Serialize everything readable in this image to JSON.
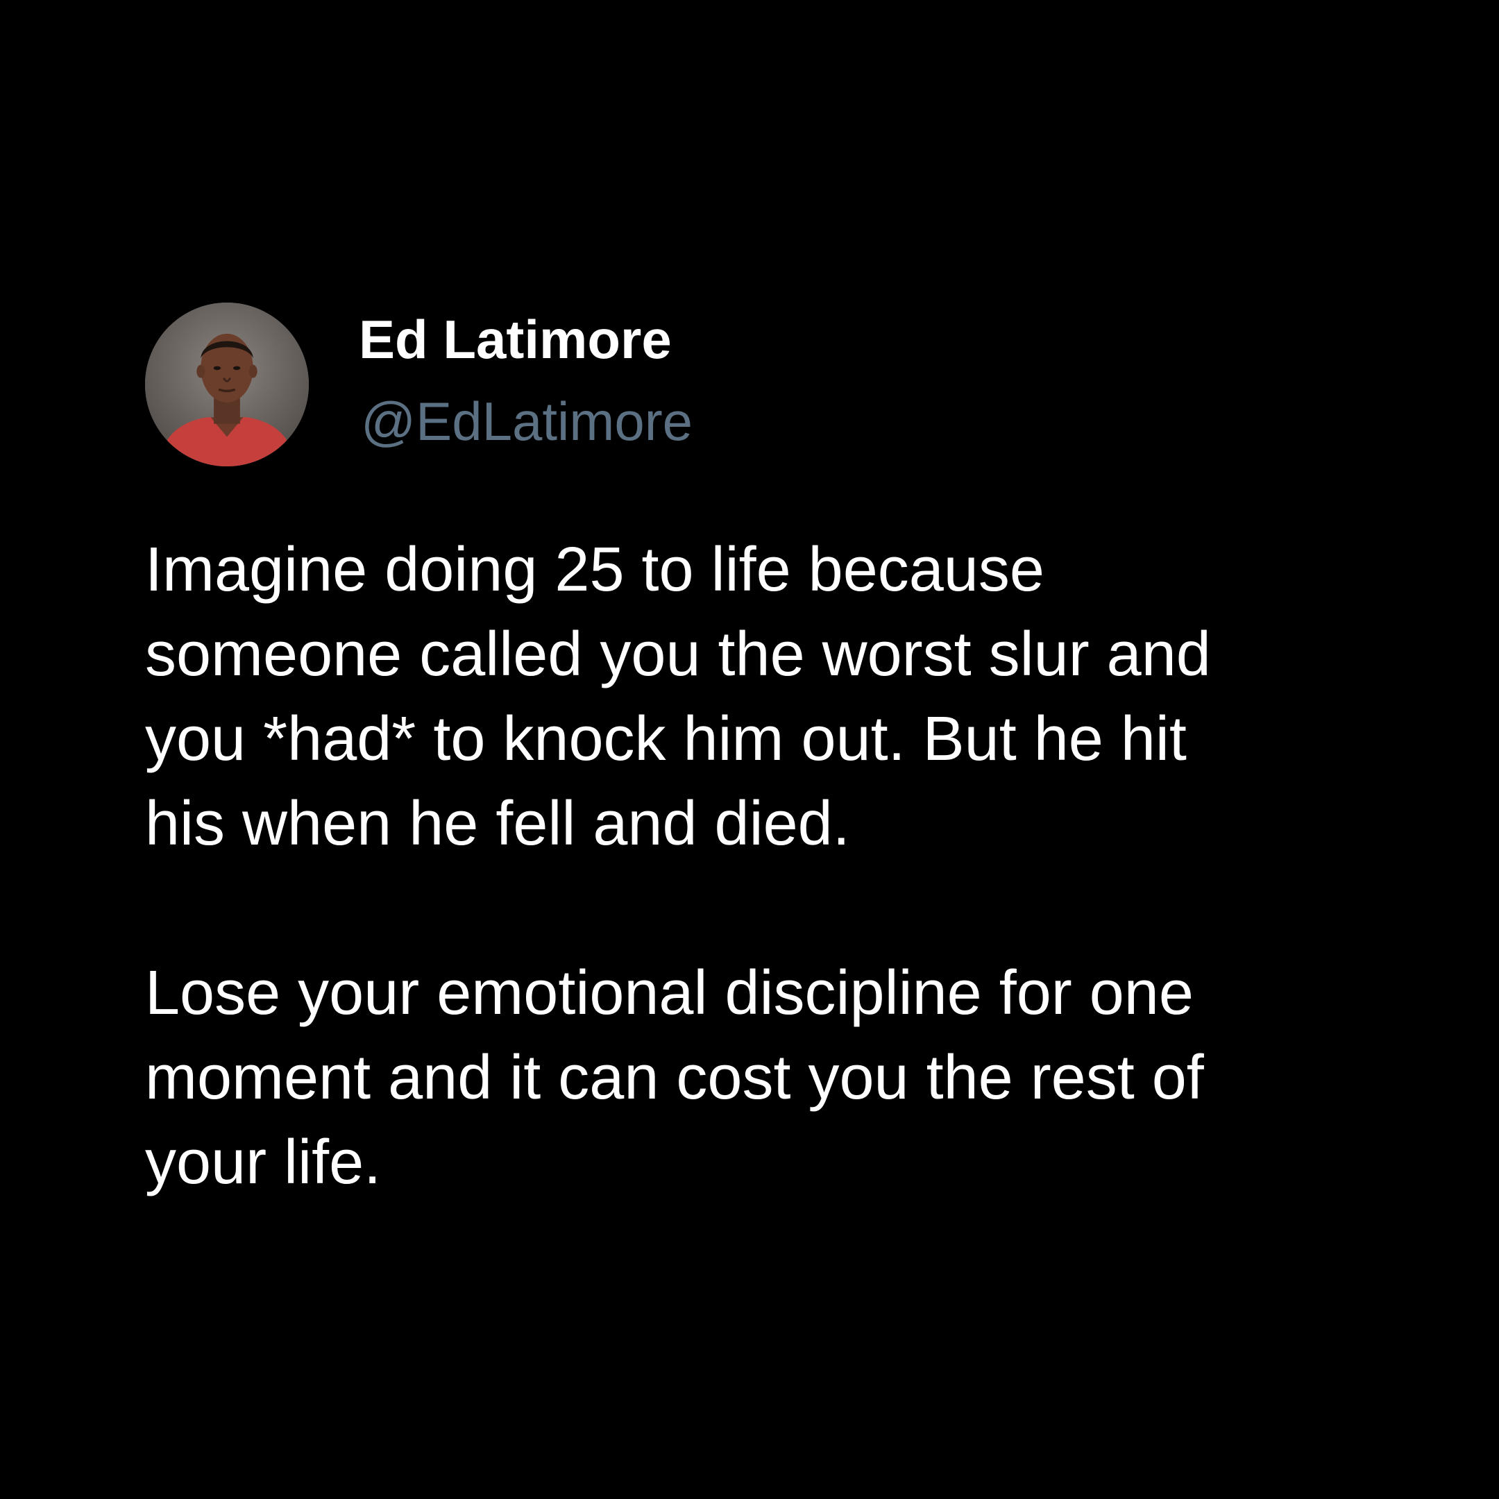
{
  "tweet": {
    "author": {
      "display_name": "Ed Latimore",
      "handle": "@EdLatimore",
      "avatar_icon": "profile-photo",
      "handle_color": "#5b7083"
    },
    "paragraphs": [
      {
        "lines": [
          "Imagine doing 25 to life because",
          "someone called you the worst slur and",
          "you *had* to knock him out. But he hit",
          "his when he fell and died."
        ]
      },
      {
        "lines": [
          "Lose your emotional discipline for one",
          "moment and it can cost you the rest of",
          "your life."
        ]
      }
    ]
  },
  "theme": {
    "background": "#000000",
    "text": "#ffffff"
  }
}
